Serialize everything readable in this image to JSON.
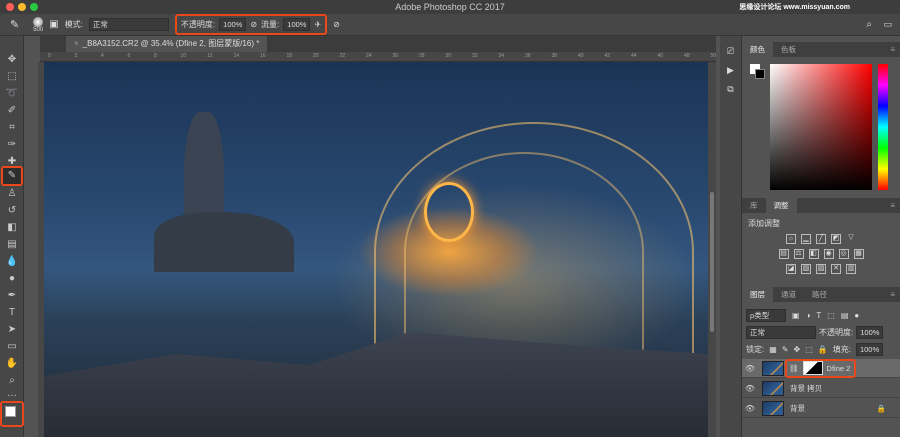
{
  "app_title": "Adobe Photoshop CC 2017",
  "watermark": "思缘设计论坛 www.missyuan.com",
  "options": {
    "brush_size": "500",
    "mode_label": "模式:",
    "mode_value": "正常",
    "opacity_label": "不透明度:",
    "opacity_value": "100%",
    "flow_label": "流量:",
    "flow_value": "100%"
  },
  "document_tab": {
    "title": "_B8A3152.CR2 @ 35.4% (Dfine 2, 图层蒙版/16) *"
  },
  "ruler_ticks": [
    "0",
    "2",
    "4",
    "6",
    "8",
    "10",
    "12",
    "14",
    "16",
    "18",
    "20",
    "22",
    "24",
    "26",
    "28",
    "30",
    "32",
    "34",
    "36",
    "38",
    "40",
    "42",
    "44",
    "46",
    "48",
    "50"
  ],
  "color_panel": {
    "tabs": [
      "颜色",
      "色板"
    ]
  },
  "adjust_panel": {
    "tabs": [
      "库",
      "调整"
    ],
    "add_label": "添加调整"
  },
  "layers_panel": {
    "tabs": [
      "图层",
      "通道",
      "路径"
    ],
    "filter": "ρ类型",
    "blend": "正常",
    "opacity_label": "不透明度:",
    "opacity_value": "100%",
    "lock_label": "锁定:",
    "fill_label": "填充:",
    "fill_value": "100%",
    "layers": [
      {
        "name": "Dfine 2"
      },
      {
        "name": "背景 拷贝"
      },
      {
        "name": "背景"
      }
    ]
  },
  "colors": {
    "highlight": "#e8481c",
    "accent": "#ff9a2e"
  }
}
